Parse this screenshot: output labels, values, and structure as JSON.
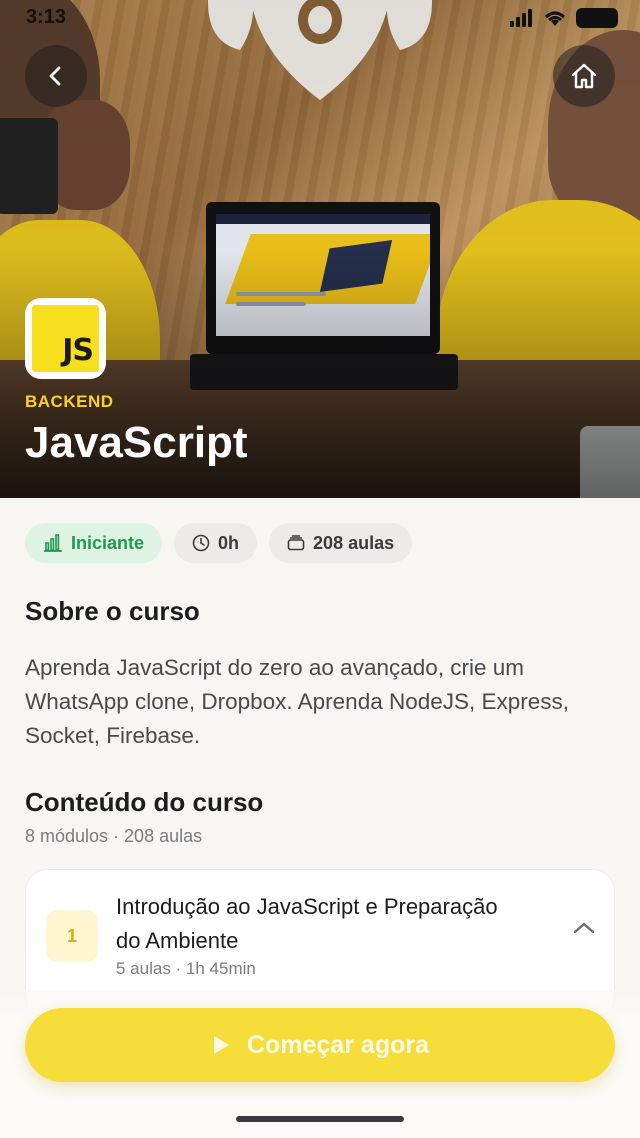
{
  "status_bar": {
    "time": "3:13"
  },
  "course": {
    "category": "BACKEND",
    "title": "JavaScript",
    "logo_text": "JS",
    "level": "Iniciante",
    "duration": "0h",
    "lessons": "208 aulas"
  },
  "about": {
    "heading": "Sobre o curso",
    "description": "Aprenda JavaScript do zero ao avançado, crie um WhatsApp clone, Dropbox. Aprenda NodeJS, Express, Socket, Firebase."
  },
  "content": {
    "heading": "Conteúdo do curso",
    "summary": "8 módulos · 208 aulas",
    "modules": [
      {
        "number": "1",
        "title": "Introdução ao JavaScript e Preparação do Ambiente",
        "meta": "5 aulas · 1h 45min"
      }
    ]
  },
  "cta": {
    "label": "Começar agora"
  },
  "colors": {
    "accent": "#f7dd3a",
    "level_green": "#1f9a4a",
    "category_yellow": "#ffd21f"
  }
}
